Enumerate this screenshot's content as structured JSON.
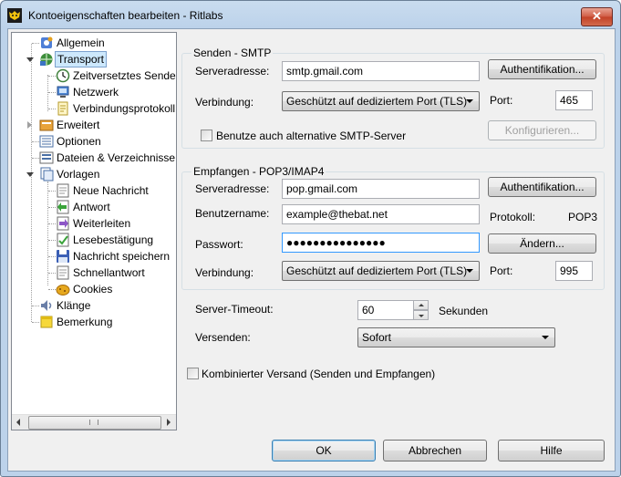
{
  "window": {
    "title": "Kontoeigenschaften bearbeiten - Ritlabs",
    "close_label": "✕"
  },
  "tree": {
    "items": [
      {
        "label": "Allgemein"
      },
      {
        "label": "Transport"
      },
      {
        "label": "Zeitversetztes Senden"
      },
      {
        "label": "Netzwerk"
      },
      {
        "label": "Verbindungsprotokoll"
      },
      {
        "label": "Erweitert"
      },
      {
        "label": "Optionen"
      },
      {
        "label": "Dateien & Verzeichnisse"
      },
      {
        "label": "Vorlagen"
      },
      {
        "label": "Neue Nachricht"
      },
      {
        "label": "Antwort"
      },
      {
        "label": "Weiterleiten"
      },
      {
        "label": "Lesebestätigung"
      },
      {
        "label": "Nachricht speichern"
      },
      {
        "label": "Schnellantwort"
      },
      {
        "label": "Cookies"
      },
      {
        "label": "Klänge"
      },
      {
        "label": "Bemerkung"
      }
    ]
  },
  "smtp": {
    "group_title": "Senden - SMTP",
    "server_label": "Serveradresse:",
    "server_value": "smtp.gmail.com",
    "auth_button": "Authentifikation...",
    "connection_label": "Verbindung:",
    "connection_value": "Geschützt auf dediziertem Port (TLS)",
    "port_label": "Port:",
    "port_value": "465",
    "alt_smtp_label": "Benutze auch alternative SMTP-Server",
    "configure_button": "Konfigurieren..."
  },
  "receive": {
    "group_title": "Empfangen - POP3/IMAP4",
    "server_label": "Serveradresse:",
    "server_value": "pop.gmail.com",
    "auth_button": "Authentifikation...",
    "user_label": "Benutzername:",
    "user_value": "example@thebat.net",
    "protocol_label": "Protokoll:",
    "protocol_value": "POP3",
    "password_label": "Passwort:",
    "password_value": "●●●●●●●●●●●●●●●",
    "change_button": "Ändern...",
    "connection_label": "Verbindung:",
    "connection_value": "Geschützt auf dediziertem Port (TLS)",
    "port_label": "Port:",
    "port_value": "995"
  },
  "timeout": {
    "label": "Server-Timeout:",
    "value": "60",
    "unit": "Sekunden"
  },
  "send": {
    "label": "Versenden:",
    "value": "Sofort"
  },
  "combined": {
    "label": "Kombinierter Versand (Senden und Empfangen)"
  },
  "footer": {
    "ok": "OK",
    "cancel": "Abbrechen",
    "help": "Hilfe"
  }
}
